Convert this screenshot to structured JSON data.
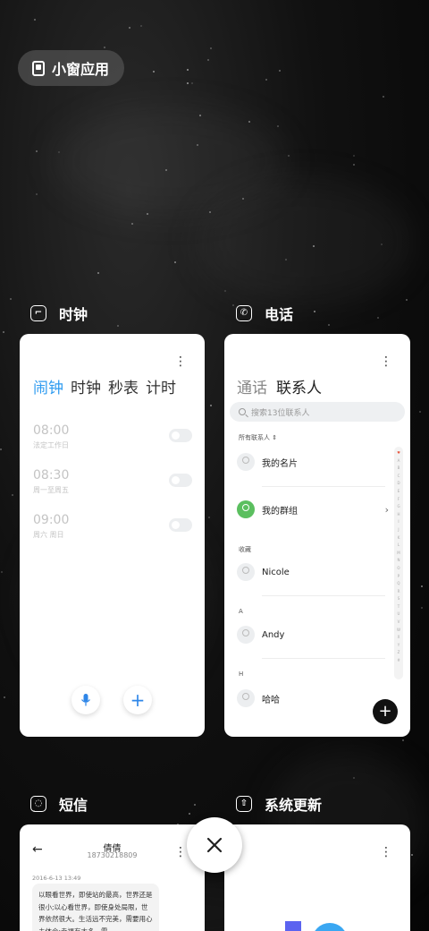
{
  "mini_window": {
    "label": "小窗应用"
  },
  "apps": [
    {
      "name": "时钟",
      "icon": "clock-icon"
    },
    {
      "name": "电话",
      "icon": "phone-icon"
    },
    {
      "name": "短信",
      "icon": "message-icon"
    },
    {
      "name": "系统更新",
      "icon": "system-update-icon"
    }
  ],
  "clock": {
    "tabs": [
      "闹钟",
      "时钟",
      "秒表",
      "计时"
    ],
    "active_tab": 0,
    "alarms": [
      {
        "time": "08:00",
        "sub": "法定工作日",
        "enabled": false
      },
      {
        "time": "08:30",
        "sub": "周一至周五",
        "enabled": false
      },
      {
        "time": "09:00",
        "sub": "周六 周日",
        "enabled": false
      }
    ],
    "mic_icon": "microphone-icon",
    "add_icon": "plus-icon"
  },
  "phone": {
    "tabs": [
      "通话",
      "联系人"
    ],
    "active_tab": 1,
    "search_placeholder": "搜索13位联系人",
    "filter_label": "所有联系人",
    "my_card": "我的名片",
    "my_groups": "我的群组",
    "section_favorites": "收藏",
    "favorite_contact": "Nicole",
    "section_a": "A",
    "contact_a": "Andy",
    "section_h": "H",
    "contact_h": "哈哈",
    "index_letters": [
      "♥",
      "A",
      "B",
      "C",
      "D",
      "E",
      "F",
      "G",
      "H",
      "I",
      "J",
      "K",
      "L",
      "M",
      "N",
      "O",
      "P",
      "Q",
      "R",
      "S",
      "T",
      "U",
      "V",
      "W",
      "X",
      "Y",
      "Z",
      "#"
    ]
  },
  "sms": {
    "contact_name": "倩倩",
    "contact_number": "18730218809",
    "date": "2016-6-13 13:49",
    "message": "以眼看世界，即使站的最高，世界还是很小;以心看世界，即使身处局限，世界依然很大。生活远不完美，需要用心去体会;幸福有太多，需"
  },
  "colors": {
    "accent_blue": "#2e9bf0",
    "group_green": "#5bbf5f"
  }
}
